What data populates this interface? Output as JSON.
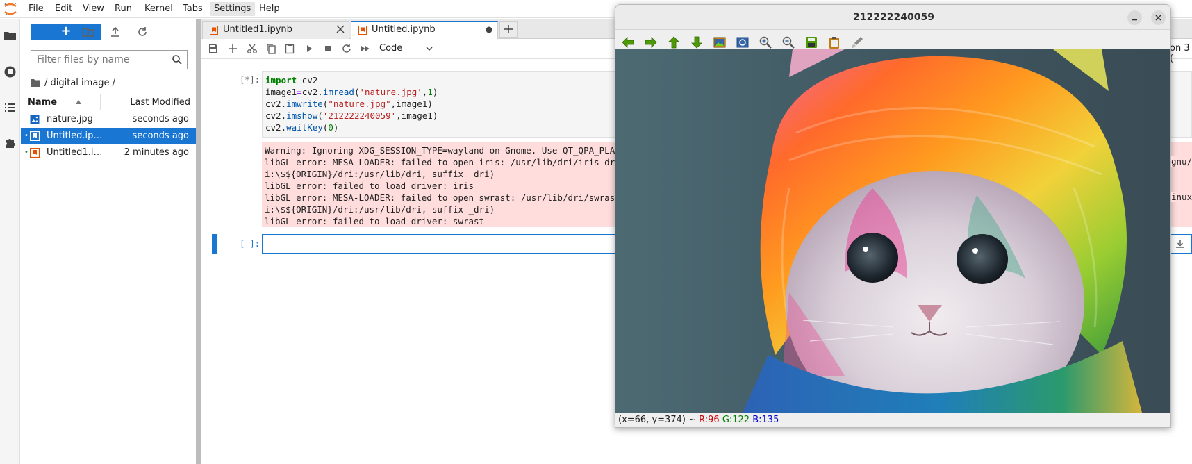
{
  "menubar": {
    "items": [
      "File",
      "Edit",
      "View",
      "Run",
      "Kernel",
      "Tabs",
      "Settings",
      "Help"
    ],
    "active": "Settings"
  },
  "filebrowser": {
    "new_label": "+",
    "filter_placeholder": "Filter files by name",
    "breadcrumb": "/ digital image /",
    "col_name": "Name",
    "col_modified": "Last Modified",
    "files": [
      {
        "name": "nature.jpg",
        "modified": "seconds ago",
        "type": "image"
      },
      {
        "name": "Untitled.ip…",
        "modified": "seconds ago",
        "type": "notebook"
      },
      {
        "name": "Untitled1.i…",
        "modified": "2 minutes ago",
        "type": "notebook"
      }
    ]
  },
  "tabs": [
    {
      "label": "Untitled1.ipynb"
    },
    {
      "label": "Untitled.ipynb"
    }
  ],
  "toolbar": {
    "cell_type": "Code",
    "kernel_label": "on 3 ("
  },
  "cells": {
    "cell1_prompt": "[*]:",
    "cell2_prompt": "[ ]:",
    "code": {
      "l1_kw": "import",
      "l1_rest": " cv2",
      "l2_a": "image1",
      "l2_op": "=",
      "l2_b": "cv2.",
      "l2_fn": "imread",
      "l2_c": "(",
      "l2_str": "'nature.jpg'",
      "l2_d": ",",
      "l2_num": "1",
      "l2_e": ")",
      "l3_a": "cv2.",
      "l3_fn": "imwrite",
      "l3_b": "(",
      "l3_str": "\"nature.jpg\"",
      "l3_c": ",image1)",
      "l4_a": "cv2.",
      "l4_fn": "imshow",
      "l4_b": "(",
      "l4_str": "'212222240059'",
      "l4_c": ",image1)",
      "l5_a": "cv2.",
      "l5_fn": "waitKey",
      "l5_b": "(",
      "l5_num": "0",
      "l5_c": ")"
    },
    "output": [
      "Warning: Ignoring XDG_SESSION_TYPE=wayland on Gnome. Use QT_QPA_PLATFORM=wayland to run on Wayland anyway.",
      "libGL error: MESA-LOADER: failed to open iris: /usr/lib/dri/iris_dri.so: cannot open shared object file: No such file or directory (search paths /usr/lib/x86_64-linux-gnu/dri:\\$${ORIGIN}/dri:/usr/lib/dri, suffix _dri)",
      "i:\\$${ORIGIN}/dri:/usr/lib/dri, suffix _dri)",
      "libGL error: failed to load driver: iris",
      "libGL error: MESA-LOADER: failed to open swrast: /usr/lib/dri/swrast_dri.so: cannot open shared object file: No such file or directory (search paths /usr/lib/x86_64-linux-",
      "i:\\$${ORIGIN}/dri:/usr/lib/dri, suffix _dri)",
      "libGL error: failed to load driver: swrast"
    ],
    "output_right": {
      "line2_tail": "gnu/",
      "line5_tail": "inux-"
    }
  },
  "image_window": {
    "title": "212222240059",
    "status": {
      "coords": "(x=66, y=374) ~",
      "r": "R:96",
      "g": "G:122",
      "b": "B:135"
    }
  },
  "colors": {
    "accent": "#1976d2",
    "error_bg": "#ffdddd"
  }
}
